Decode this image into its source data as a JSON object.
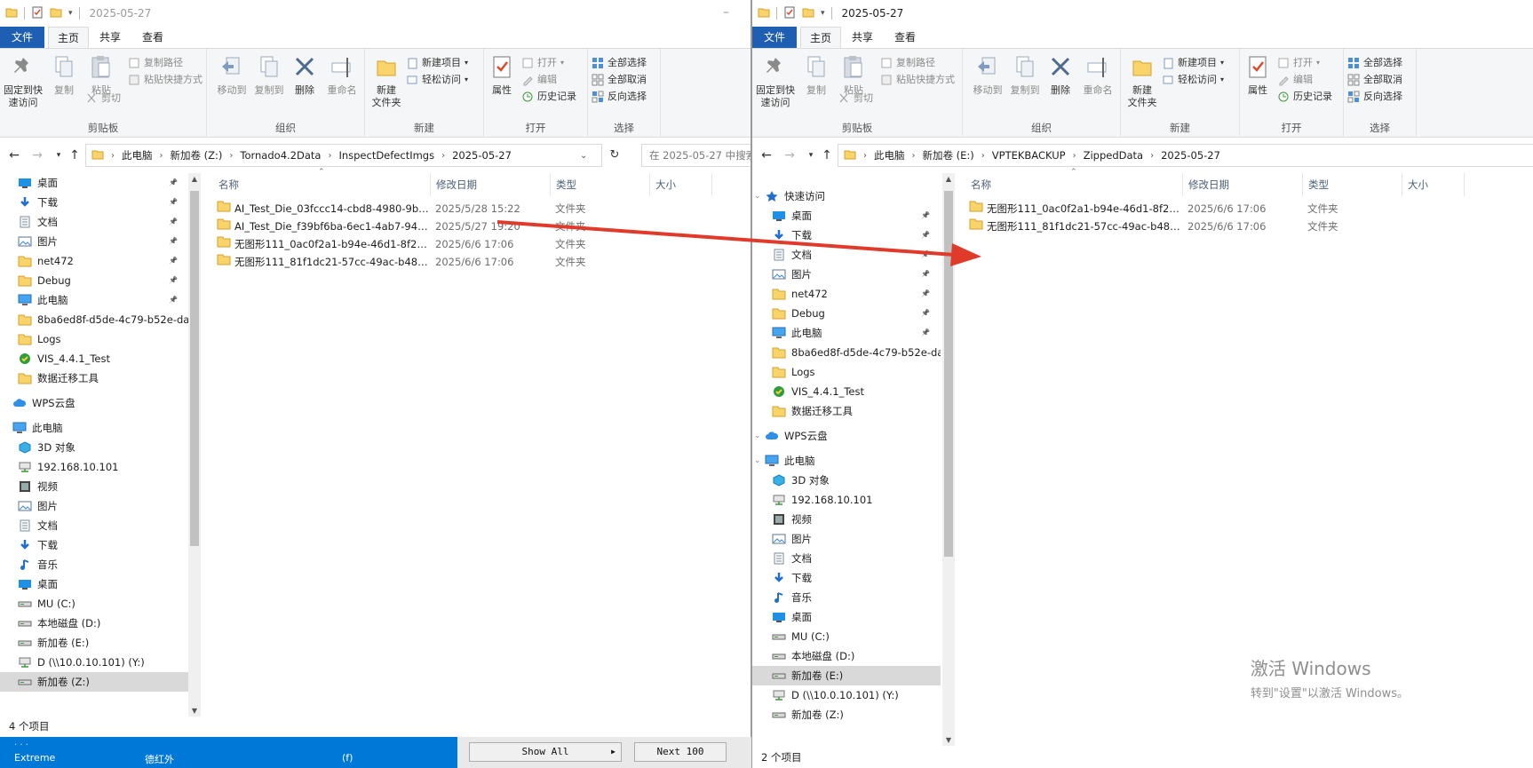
{
  "left_window": {
    "title": "2025-05-27",
    "tabs": {
      "file": "文件",
      "home": "主页",
      "share": "共享",
      "view": "查看"
    },
    "ribbon": {
      "pin_quick_access": "固定到快\n速访问",
      "copy": "复制",
      "paste": "粘贴",
      "copy_path": "复制路径",
      "paste_shortcut": "粘贴快捷方式",
      "cut": "剪切",
      "clipboard_group": "剪贴板",
      "move_to": "移动到",
      "copy_to": "复制到",
      "delete": "删除",
      "rename": "重命名",
      "organize_group": "组织",
      "new_folder": "新建\n文件夹",
      "new_item": "新建项目",
      "easy_access": "轻松访问",
      "new_group": "新建",
      "properties": "属性",
      "open": "打开",
      "edit": "编辑",
      "history": "历史记录",
      "open_group": "打开",
      "select_all": "全部选择",
      "select_none": "全部取消",
      "invert_selection": "反向选择",
      "select_group": "选择"
    },
    "breadcrumb": [
      "此电脑",
      "新加卷 (Z:)",
      "Tornado4.2Data",
      "InspectDefectImgs",
      "2025-05-27"
    ],
    "search_placeholder": "在 2025-05-27 中搜索",
    "nav_items": [
      {
        "label": "桌面",
        "icon": "desktop-icon",
        "pin": true
      },
      {
        "label": "下载",
        "icon": "download-icon",
        "pin": true
      },
      {
        "label": "文档",
        "icon": "document-icon",
        "pin": true
      },
      {
        "label": "图片",
        "icon": "pictures-icon",
        "pin": true
      },
      {
        "label": "net472",
        "icon": "folder-icon",
        "pin": true
      },
      {
        "label": "Debug",
        "icon": "folder-icon",
        "pin": true
      },
      {
        "label": "此电脑",
        "icon": "computer-icon",
        "pin": true
      },
      {
        "label": "8ba6ed8f-d5de-4c79-b52e-da",
        "icon": "folder-icon",
        "pin": false
      },
      {
        "label": "Logs",
        "icon": "folder-icon",
        "pin": false
      },
      {
        "label": "VIS_4.4.1_Test",
        "icon": "vis-icon",
        "pin": false
      },
      {
        "label": "数据迁移工具",
        "icon": "folder-icon",
        "pin": false
      },
      {
        "label": "WPS云盘",
        "icon": "cloud-icon",
        "pin": false
      },
      {
        "label": "此电脑",
        "icon": "computer-icon",
        "pin": false
      },
      {
        "label": "3D 对象",
        "icon": "3d-objects-icon",
        "pin": false
      },
      {
        "label": "192.168.10.101",
        "icon": "network-drive-icon",
        "pin": false
      },
      {
        "label": "视频",
        "icon": "video-icon",
        "pin": false
      },
      {
        "label": "图片",
        "icon": "pictures-icon",
        "pin": false
      },
      {
        "label": "文档",
        "icon": "document-icon",
        "pin": false
      },
      {
        "label": "下载",
        "icon": "download-icon",
        "pin": false
      },
      {
        "label": "音乐",
        "icon": "music-icon",
        "pin": false
      },
      {
        "label": "桌面",
        "icon": "desktop-icon",
        "pin": false
      },
      {
        "label": "MU (C:)",
        "icon": "drive-icon",
        "pin": false
      },
      {
        "label": "本地磁盘 (D:)",
        "icon": "drive-icon",
        "pin": false
      },
      {
        "label": "新加卷 (E:)",
        "icon": "drive-icon",
        "pin": false
      },
      {
        "label": "D (\\\\10.0.10.101) (Y:)",
        "icon": "network-drive-icon",
        "pin": false
      },
      {
        "label": "新加卷 (Z:)",
        "icon": "drive-icon",
        "pin": false,
        "selected": true
      }
    ],
    "columns": {
      "name": "名称",
      "modified": "修改日期",
      "type": "类型",
      "size": "大小"
    },
    "files": [
      {
        "name": "AI_Test_Die_03fccc14-cbd8-4980-9b9...",
        "modified": "2025/5/28 15:22",
        "type": "文件夹"
      },
      {
        "name": "AI_Test_Die_f39bf6ba-6ec1-4ab7-94a...",
        "modified": "2025/5/27 19:20",
        "type": "文件夹"
      },
      {
        "name": "无图形111_0ac0f2a1-b94e-46d1-8f22-...",
        "modified": "2025/6/6 17:06",
        "type": "文件夹"
      },
      {
        "name": "无图形111_81f1dc21-57cc-49ac-b487-...",
        "modified": "2025/6/6 17:06",
        "type": "文件夹"
      }
    ],
    "status": "4 个项目"
  },
  "right_window": {
    "title": "2025-05-27",
    "tabs": {
      "file": "文件",
      "home": "主页",
      "share": "共享",
      "view": "查看"
    },
    "ribbon": {
      "pin_quick_access": "固定到快\n速访问",
      "copy": "复制",
      "paste": "粘贴",
      "copy_path": "复制路径",
      "paste_shortcut": "粘贴快捷方式",
      "cut": "剪切",
      "clipboard_group": "剪贴板",
      "move_to": "移动到",
      "copy_to": "复制到",
      "delete": "删除",
      "rename": "重命名",
      "organize_group": "组织",
      "new_folder": "新建\n文件夹",
      "new_item": "新建项目",
      "easy_access": "轻松访问",
      "new_group": "新建",
      "properties": "属性",
      "open": "打开",
      "edit": "编辑",
      "history": "历史记录",
      "open_group": "打开",
      "select_all": "全部选择",
      "select_none": "全部取消",
      "invert_selection": "反向选择",
      "select_group": "选择"
    },
    "breadcrumb": [
      "此电脑",
      "新加卷 (E:)",
      "VPTEKBACKUP",
      "ZippedData",
      "2025-05-27"
    ],
    "nav_items": [
      {
        "label": "快速访问",
        "icon": "star-icon",
        "pin": false,
        "level": 0
      },
      {
        "label": "桌面",
        "icon": "desktop-icon",
        "pin": true,
        "level": 1
      },
      {
        "label": "下载",
        "icon": "download-icon",
        "pin": true,
        "level": 1
      },
      {
        "label": "文档",
        "icon": "document-icon",
        "pin": true,
        "level": 1
      },
      {
        "label": "图片",
        "icon": "pictures-icon",
        "pin": true,
        "level": 1
      },
      {
        "label": "net472",
        "icon": "folder-icon",
        "pin": true,
        "level": 1
      },
      {
        "label": "Debug",
        "icon": "folder-icon",
        "pin": true,
        "level": 1
      },
      {
        "label": "此电脑",
        "icon": "computer-icon",
        "pin": true,
        "level": 1
      },
      {
        "label": "8ba6ed8f-d5de-4c79-b52e-da",
        "icon": "folder-icon",
        "pin": false,
        "level": 1
      },
      {
        "label": "Logs",
        "icon": "folder-icon",
        "pin": false,
        "level": 1
      },
      {
        "label": "VIS_4.4.1_Test",
        "icon": "vis-icon",
        "pin": false,
        "level": 1
      },
      {
        "label": "数据迁移工具",
        "icon": "folder-icon",
        "pin": false,
        "level": 1
      },
      {
        "label": "WPS云盘",
        "icon": "cloud-icon",
        "pin": false,
        "level": 0
      },
      {
        "label": "此电脑",
        "icon": "computer-icon",
        "pin": false,
        "level": 0
      },
      {
        "label": "3D 对象",
        "icon": "3d-objects-icon",
        "pin": false,
        "level": 1
      },
      {
        "label": "192.168.10.101",
        "icon": "network-drive-icon",
        "pin": false,
        "level": 1
      },
      {
        "label": "视频",
        "icon": "video-icon",
        "pin": false,
        "level": 1
      },
      {
        "label": "图片",
        "icon": "pictures-icon",
        "pin": false,
        "level": 1
      },
      {
        "label": "文档",
        "icon": "document-icon",
        "pin": false,
        "level": 1
      },
      {
        "label": "下载",
        "icon": "download-icon",
        "pin": false,
        "level": 1
      },
      {
        "label": "音乐",
        "icon": "music-icon",
        "pin": false,
        "level": 1
      },
      {
        "label": "桌面",
        "icon": "desktop-icon",
        "pin": false,
        "level": 1
      },
      {
        "label": "MU (C:)",
        "icon": "drive-icon",
        "pin": false,
        "level": 1
      },
      {
        "label": "本地磁盘 (D:)",
        "icon": "drive-icon",
        "pin": false,
        "level": 1
      },
      {
        "label": "新加卷 (E:)",
        "icon": "drive-icon",
        "pin": false,
        "level": 1,
        "selected": true
      },
      {
        "label": "D (\\\\10.0.10.101) (Y:)",
        "icon": "network-drive-icon",
        "pin": false,
        "level": 1
      },
      {
        "label": "新加卷 (Z:)",
        "icon": "drive-icon",
        "pin": false,
        "level": 1
      }
    ],
    "columns": {
      "name": "名称",
      "modified": "修改日期",
      "type": "类型",
      "size": "大小"
    },
    "files": [
      {
        "name": "无图形111_0ac0f2a1-b94e-46d1-8f22-...",
        "modified": "2025/6/6 17:06",
        "type": "文件夹"
      },
      {
        "name": "无图形111_81f1dc21-57cc-49ac-b487-...",
        "modified": "2025/6/6 17:06",
        "type": "文件夹"
      }
    ],
    "status": "2 个项目"
  },
  "taskbar": {
    "extreme_label": "Extreme",
    "snippet_2": "德红外",
    "snippet_3": "(f)",
    "show_all": "Show All",
    "next_100": "Next 100"
  },
  "watermark": {
    "line1": "激活 Windows",
    "line2": "转到\"设置\"以激活 Windows。"
  },
  "colors": {
    "file_tab": "#1f5fb3",
    "arrow": "#e03a2a",
    "taskbar_blue": "#0078d7",
    "folder": "#f8d46a"
  }
}
